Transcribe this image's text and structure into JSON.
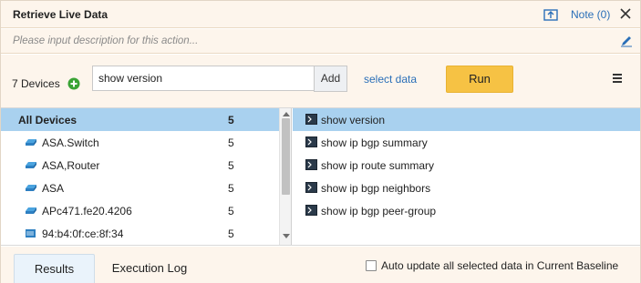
{
  "header": {
    "title": "Retrieve Live Data",
    "note_label": "Note (0)"
  },
  "description": {
    "placeholder": "Please input description for this action..."
  },
  "toolbar": {
    "devices_label": "7 Devices",
    "command_value": "show version",
    "add_label": "Add",
    "select_data_label": "select data",
    "run_label": "Run"
  },
  "devices": {
    "header": {
      "name": "All Devices",
      "count": "5"
    },
    "items": [
      {
        "name": "ASA.Switch",
        "count": "5",
        "icon": "switch-icon"
      },
      {
        "name": "ASA,Router",
        "count": "5",
        "icon": "router-icon"
      },
      {
        "name": "ASA",
        "count": "5",
        "icon": "firewall-icon"
      },
      {
        "name": "APc471.fe20.4206",
        "count": "5",
        "icon": "access-point-icon"
      },
      {
        "name": "94:b4:0f:ce:8f:34",
        "count": "5",
        "icon": "server-icon"
      }
    ]
  },
  "commands": [
    {
      "name": "show version"
    },
    {
      "name": "show ip bgp summary"
    },
    {
      "name": "show ip route summary"
    },
    {
      "name": "show ip bgp neighbors"
    },
    {
      "name": "show ip bgp peer-group"
    }
  ],
  "bottom": {
    "tabs": [
      {
        "label": "Results"
      },
      {
        "label": "Execution Log"
      }
    ],
    "auto_update_label": "Auto update all selected data in Current Baseline",
    "auto_update_checked": false
  },
  "colors": {
    "accent_link": "#2a6fb8",
    "run_button": "#f6c244",
    "selection": "#a9d1ef",
    "add_device": "#3aa335"
  }
}
